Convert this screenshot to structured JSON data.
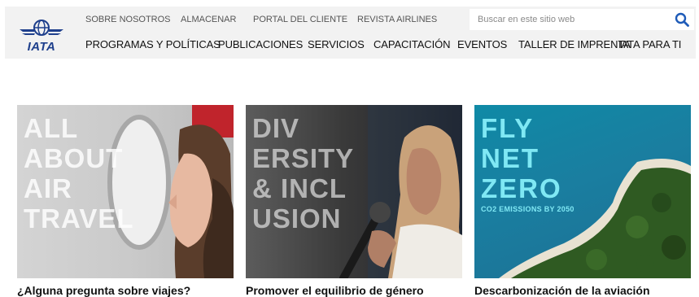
{
  "logo": {
    "text": "IATA"
  },
  "top_nav": [
    {
      "label": "SOBRE NOSOTROS"
    },
    {
      "label": "ALMACENAR"
    },
    {
      "label": "PORTAL DEL CLIENTE"
    },
    {
      "label": "REVISTA AIRLINES"
    }
  ],
  "search": {
    "placeholder": "Buscar en este sitio web"
  },
  "main_nav": [
    {
      "label": "PROGRAMAS Y POLÍTICAS"
    },
    {
      "label": "PUBLICACIONES"
    },
    {
      "label": "SERVICIOS"
    },
    {
      "label": "CAPACITACIÓN"
    },
    {
      "label": "EVENTOS"
    },
    {
      "label": "TALLER DE IMPRENTA"
    },
    {
      "label": "IATA PARA TI"
    }
  ],
  "cards": [
    {
      "overlay": "ALL\nABOUT\nAIR\nTRAVEL",
      "title": "¿Alguna pregunta sobre viajes?"
    },
    {
      "overlay": "DIV\nERSITY\n& INCL\nUSION",
      "title": "Promover el equilibrio de género"
    },
    {
      "overlay": "FLY\nNET\nZERO",
      "subtitle": "CO2 EMISSIONS BY 2050",
      "title": "Descarbonización de la aviación"
    }
  ],
  "colors": {
    "brand": "#1e3f8c",
    "header_bg": "#f2f2f2",
    "search_icon": "#1e5bb8"
  }
}
